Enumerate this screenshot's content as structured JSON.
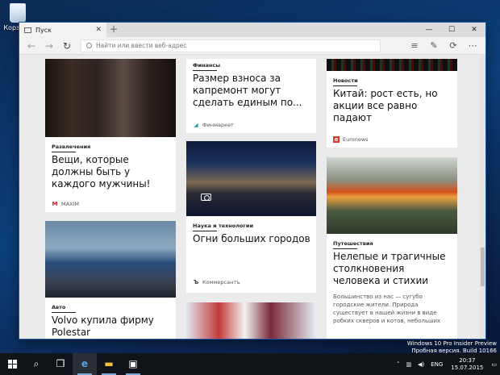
{
  "desktop": {
    "recycle_bin_label": "Корзина"
  },
  "browser": {
    "tab_title": "Пуск",
    "address_placeholder": "Найти или ввести веб-адрес"
  },
  "cards": {
    "fashion": {
      "category": "Развлечения",
      "headline": "Вещи, которые должны быть у каждого мужчины!",
      "source": "MAXIM",
      "source_logo": "M"
    },
    "levy": {
      "category": "Финансы",
      "headline": "Размер взноса за капремонт могут сделать единым по...",
      "source": "Финмаркет"
    },
    "china": {
      "category": "Новости",
      "headline": "Китай: рост есть, но акции все равно падают",
      "source": "Euronews"
    },
    "city": {
      "category": "Наука и технологии",
      "headline": "Огни больших городов",
      "source": "Коммерсантъ",
      "source_logo": "Ъ"
    },
    "cars": {
      "category": "Авто",
      "headline": "Volvo купила фирму Polestar"
    },
    "clashes": {
      "category": "Путешествия",
      "headline": "Нелепые и трагичные столкновения человека и стихии",
      "snippet": "Большинство из нас — сугубо городские жители. Природа существует в нашей жизни в виде робких скверов и котов, небольших"
    }
  },
  "taskbar": {
    "language": "ENG",
    "time": "20:37",
    "date": "15.07.2015"
  },
  "watermark": {
    "line1": "Windows 10 Pro Insider Preview",
    "line2": "Пробная версия. Build 10166"
  },
  "colors": {
    "maxim_red": "#d21f26",
    "finmarket_teal": "#2aa5a5",
    "euronews_red": "#d83a2c",
    "accent_blue": "#78a8d8"
  }
}
